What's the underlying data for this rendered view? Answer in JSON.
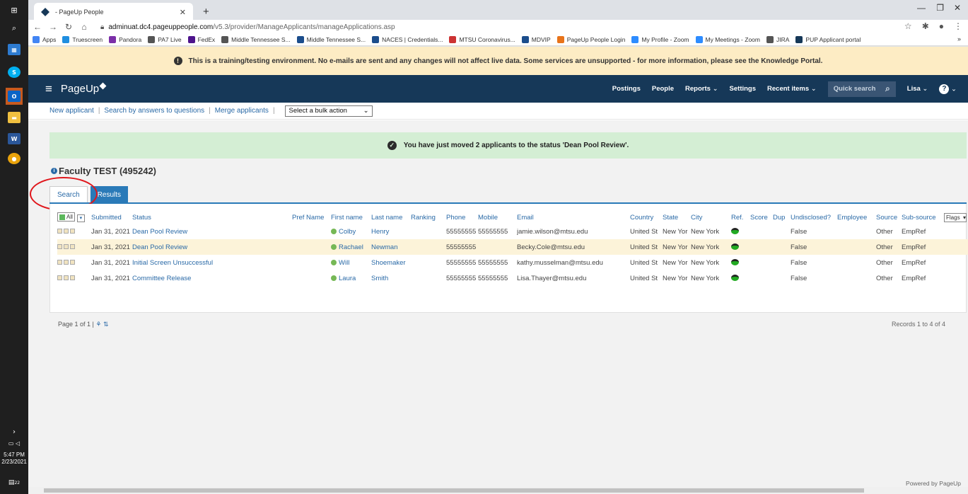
{
  "taskbar": {
    "time": "5:47 PM",
    "date": "2/23/2021",
    "notif_count": "22"
  },
  "browser": {
    "tab_title": "- PageUp People",
    "url_host": "adminuat.dc4.pageuppeople.com",
    "url_path": "/v5.3/provider/ManageApplicants/manageApplications.asp",
    "bookmarks": [
      "Apps",
      "Truescreen",
      "Pandora",
      "PA7 Live",
      "FedEx",
      "Middle Tennessee S...",
      "Middle Tennessee S...",
      "NACES | Credentials...",
      "MTSU Coronavirus...",
      "MDVIP",
      "PageUp People Login",
      "My Profile - Zoom",
      "My Meetings - Zoom",
      "JIRA",
      "PUP Applicant portal"
    ],
    "more": "»"
  },
  "banner": {
    "text": "This is a training/testing environment. No e-mails are sent and any changes will not affect live data. Some services are unsupported - for more information, please see the Knowledge Portal."
  },
  "nav": {
    "logo": "PageUp",
    "postings": "Postings",
    "people": "People",
    "reports": "Reports",
    "settings": "Settings",
    "recent": "Recent items",
    "quick_search": "Quick search",
    "user": "Lisa"
  },
  "actions": {
    "new_applicant": "New applicant",
    "search_answers": "Search by answers to questions",
    "merge": "Merge applicants",
    "bulk": "Select a bulk action"
  },
  "success_msg": "You have just moved 2 applicants to the status 'Dean Pool Review'.",
  "job_title": "Faculty TEST (495242)",
  "tabs": {
    "search": "Search",
    "results": "Results"
  },
  "table": {
    "all_label": "All",
    "headers": [
      "Submitted",
      "Status",
      "Pref Name",
      "First name",
      "Last name",
      "Ranking",
      "Phone",
      "Mobile",
      "Email",
      "Country",
      "State",
      "City",
      "Ref.",
      "Score",
      "Dup",
      "Undisclosed?",
      "Employee",
      "Source",
      "Sub-source"
    ],
    "flags_label": "Flags",
    "rows": [
      {
        "submitted": "Jan 31, 2021",
        "status": "Dean Pool Review",
        "first": "Colby",
        "last": "Henry",
        "phone": "55555555",
        "mobile": "55555555",
        "email": "jamie.wilson@mtsu.edu",
        "country": "United St",
        "state": "New Yor",
        "city": "New York",
        "undisclosed": "False",
        "source": "Other",
        "subsource": "EmpRef"
      },
      {
        "submitted": "Jan 31, 2021",
        "status": "Dean Pool Review",
        "first": "Rachael",
        "last": "Newman",
        "phone": "55555555",
        "mobile": "",
        "email": "Becky.Cole@mtsu.edu",
        "country": "United St",
        "state": "New Yor",
        "city": "New York",
        "undisclosed": "False",
        "source": "Other",
        "subsource": "EmpRef"
      },
      {
        "submitted": "Jan 31, 2021",
        "status": "Initial Screen Unsuccessful",
        "first": "Will",
        "last": "Shoemaker",
        "phone": "55555555",
        "mobile": "55555555",
        "email": "kathy.musselman@mtsu.edu",
        "country": "United St",
        "state": "New Yor",
        "city": "New York",
        "undisclosed": "False",
        "source": "Other",
        "subsource": "EmpRef"
      },
      {
        "submitted": "Jan 31, 2021",
        "status": "Committee Release",
        "first": "Laura",
        "last": "Smith",
        "phone": "55555555",
        "mobile": "55555555",
        "email": "Lisa.Thayer@mtsu.edu",
        "country": "United St",
        "state": "New Yor",
        "city": "New York",
        "undisclosed": "False",
        "source": "Other",
        "subsource": "EmpRef"
      }
    ]
  },
  "pager": {
    "text": "Page 1 of 1",
    "records": "Records 1 to 4 of 4"
  },
  "footer": {
    "powered": "Powered by PageUp"
  }
}
